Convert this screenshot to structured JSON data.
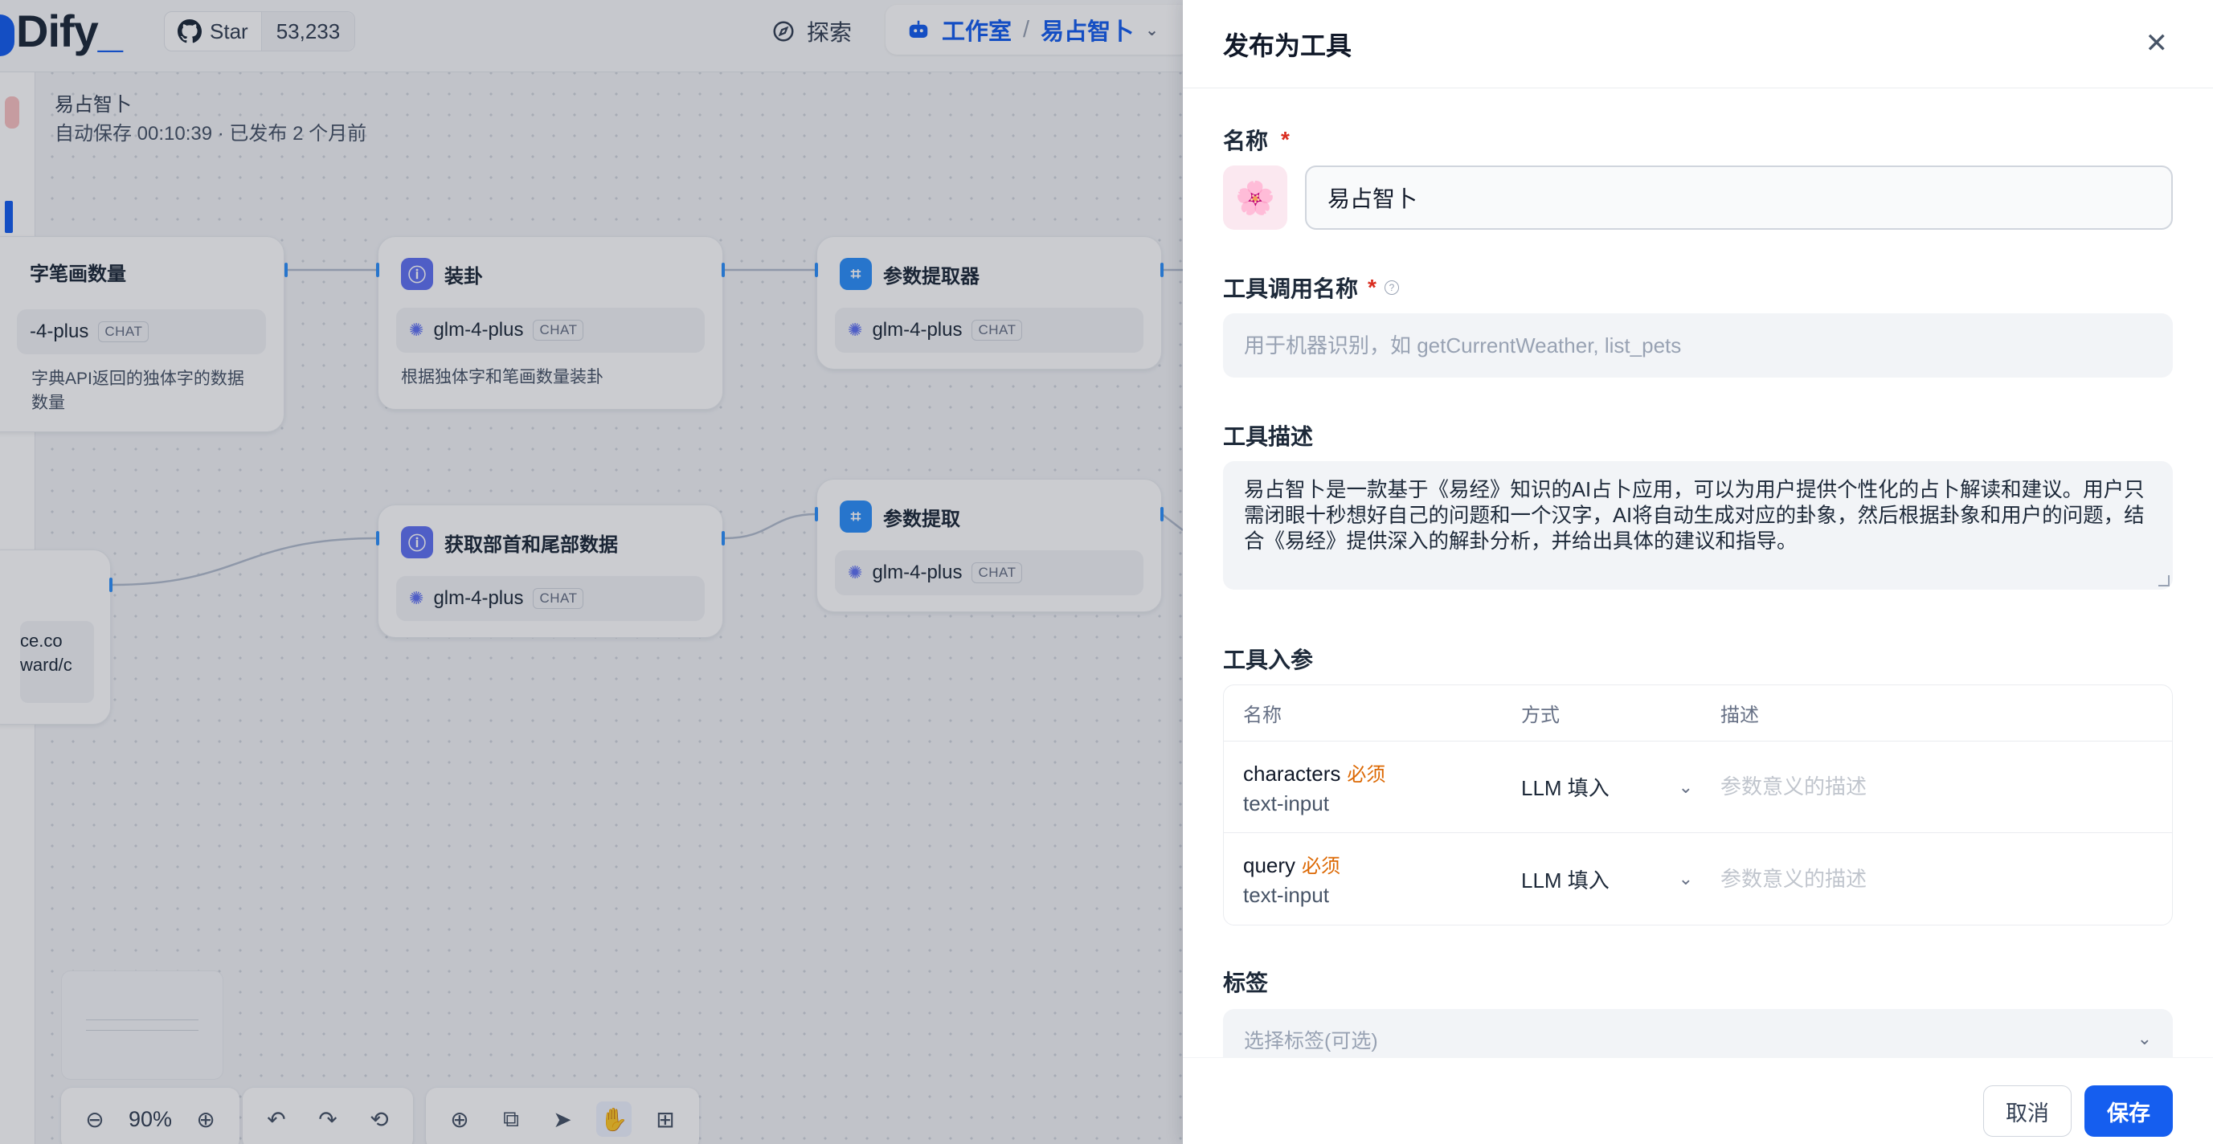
{
  "topbar": {
    "logo_text": "Dify",
    "github_star_label": "Star",
    "github_star_count": "53,233",
    "explore_label": "探索",
    "studio_label": "工作室",
    "breadcrumb_separator": "/",
    "app_breadcrumb": "易占智卜"
  },
  "app_header": {
    "title": "易占智卜",
    "status": "自动保存 00:10:39 · 已发布 2 个月前"
  },
  "workflow": {
    "nodes": [
      {
        "title": "汉字笔画数量",
        "visible_title": "字笔画数量",
        "model": "-4-plus",
        "tag": "CHAT",
        "desc_lines": [
          "字典API返回的独体字的数据",
          "数量"
        ]
      },
      {
        "title": "装卦",
        "model": "glm-4-plus",
        "tag": "CHAT",
        "desc_lines": [
          "根据独体字和笔画数量装卦"
        ]
      },
      {
        "title": "参数提取器",
        "model": "glm-4-plus",
        "tag": "CHAT",
        "desc_lines": []
      },
      {
        "title": "获取部首和尾部数据",
        "model": "glm-4-plus",
        "tag": "CHAT",
        "desc_lines": []
      },
      {
        "title": "参数提取",
        "model": "glm-4-plus",
        "tag": "CHAT",
        "desc_lines": []
      },
      {
        "title": "",
        "url_lines": [
          "ce.co",
          "ward/c"
        ]
      }
    ],
    "zoom_label": "90%"
  },
  "drawer": {
    "title": "发布为工具",
    "close_icon": "close-icon",
    "name_label": "名称",
    "required_mark": "*",
    "emoji": "🌸",
    "name_value": "易占智卜",
    "call_name_label": "工具调用名称",
    "call_name_placeholder": "用于机器识别，如 getCurrentWeather, list_pets",
    "description_label": "工具描述",
    "description_value": "易占智卜是一款基于《易经》知识的AI占卜应用，可以为用户提供个性化的占卜解读和建议。用户只需闭眼十秒想好自己的问题和一个汉字，AI将自动生成对应的卦象，然后根据卦象和用户的问题，结合《易经》提供深入的解卦分析，并给出具体的建议和指导。",
    "params_label": "工具入参",
    "params_headers": {
      "name": "名称",
      "method": "方式",
      "desc": "描述"
    },
    "params": [
      {
        "name": "characters",
        "required_label": "必须",
        "type": "text-input",
        "method": "LLM 填入",
        "desc_placeholder": "参数意义的描述"
      },
      {
        "name": "query",
        "required_label": "必须",
        "type": "text-input",
        "method": "LLM 填入",
        "desc_placeholder": "参数意义的描述"
      }
    ],
    "tags_label": "标签",
    "tags_placeholder": "选择标签(可选)",
    "cancel_label": "取消",
    "save_label": "保存"
  },
  "colors": {
    "accent": "#155eef",
    "required": "#d92d20",
    "must_badge": "#dc6803",
    "node_icon_purple": "#6172f3",
    "node_icon_blue": "#2e90fa"
  }
}
